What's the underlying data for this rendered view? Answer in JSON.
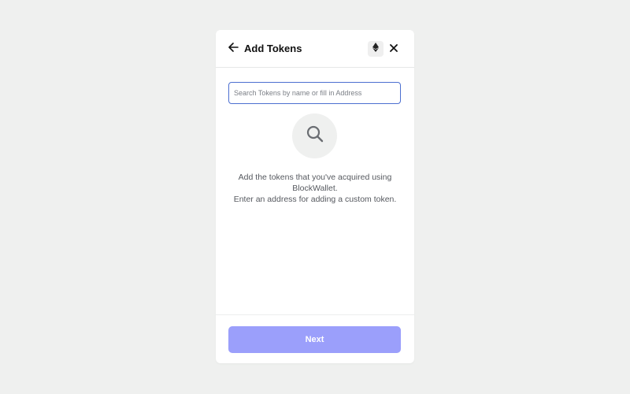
{
  "header": {
    "title": "Add Tokens",
    "back_icon": "arrow-left-icon",
    "network_icon": "ethereum-icon",
    "close_icon": "close-icon"
  },
  "search": {
    "placeholder": "Search Tokens by name or fill in Address",
    "value": "",
    "icon": "search-icon"
  },
  "empty_state": {
    "line1": "Add the tokens that you've acquired using BlockWallet.",
    "line2": "Enter an address for adding a custom token."
  },
  "footer": {
    "next_label": "Next"
  },
  "colors": {
    "background": "#eff0ef",
    "input_border": "#4c6fd0",
    "next_button": "#9b9ffb",
    "text_muted": "#56595f"
  }
}
